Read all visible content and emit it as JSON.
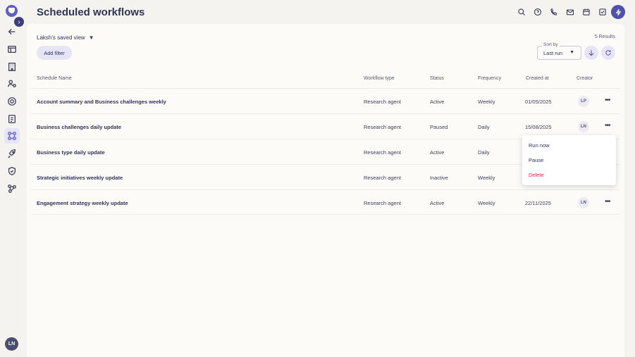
{
  "header": {
    "title": "Scheduled workflows",
    "icons": [
      "search-icon",
      "help-icon",
      "phone-icon",
      "mail-icon",
      "calendar-icon",
      "checklist-icon",
      "bolt-icon"
    ]
  },
  "sidebar": {
    "items": [
      "back-icon",
      "layout-icon",
      "building-icon",
      "users-icon",
      "eye-icon",
      "clipboard-icon",
      "workflow-icon",
      "rocket-icon",
      "shield-icon",
      "integrations-icon"
    ],
    "active": "workflow-icon",
    "user_initials": "LN"
  },
  "toolbar": {
    "saved_view": "Laksh's saved view",
    "results": "5 Results",
    "add_filter": "Add filter",
    "sort_label": "Sort by",
    "sort_value": "Last run"
  },
  "table": {
    "headers": {
      "name": "Schedule Name",
      "type": "Workflow type",
      "status": "Status",
      "frequency": "Frequency",
      "created": "Created at",
      "creator": "Creator"
    },
    "rows": [
      {
        "name": "Account summary and Business challenges weekly",
        "type": "Research agent",
        "status": "Active",
        "frequency": "Weekly",
        "created": "01/05/2025",
        "creator": "LP"
      },
      {
        "name": "Business challenges daily update",
        "type": "Research agent",
        "status": "Paused",
        "frequency": "Daily",
        "created": "15/08/2025",
        "creator": "LN"
      },
      {
        "name": "Business type daily update",
        "type": "Research agent",
        "status": "Active",
        "frequency": "Daily",
        "created": "",
        "creator": ""
      },
      {
        "name": "Strategic initiatives weekly update",
        "type": "Research agent",
        "status": "Inactive",
        "frequency": "Weekly",
        "created": "",
        "creator": ""
      },
      {
        "name": "Engagement strategy weekly update",
        "type": "Research agent",
        "status": "Active",
        "frequency": "Weekly",
        "created": "22/11/2025",
        "creator": "LN"
      }
    ]
  },
  "menu": {
    "items": [
      "Run now",
      "Pause",
      "Delete"
    ]
  },
  "colors": {
    "accent": "#5b5fc7",
    "danger": "#d6334e"
  }
}
